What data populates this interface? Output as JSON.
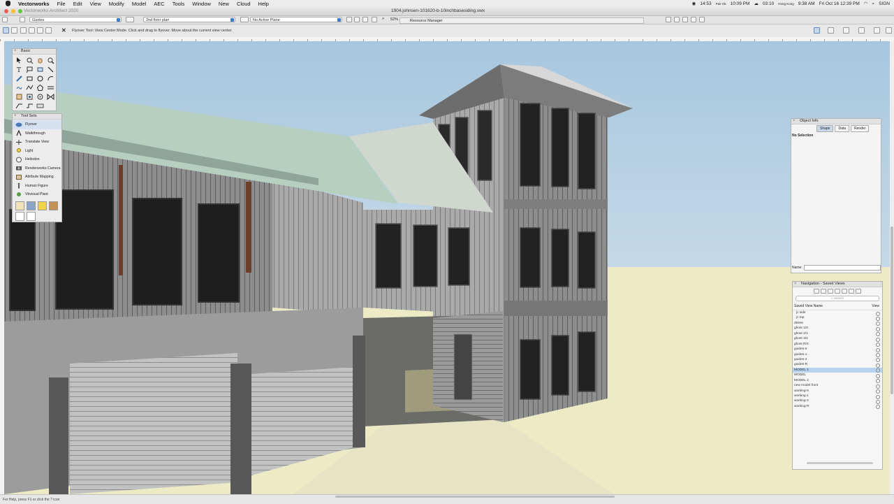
{
  "menubar": {
    "app": "Vectorworks",
    "items": [
      "File",
      "Edit",
      "View",
      "Modify",
      "Model",
      "AEC",
      "Tools",
      "Window",
      "New",
      "Cloud",
      "Help"
    ],
    "status": {
      "time_1": "14:53",
      "zone_1": "Pair Ok",
      "time_2": "10:09 PM",
      "time_3": "03:10",
      "zone_2": "Hong Kong",
      "time_4": "9:38 AM",
      "datetime": "Fri Oct 16  12:39 PM",
      "user": "SIGN"
    }
  },
  "window": {
    "app_version": "Vectorworks Architect 2020",
    "document_title": "1904.johnsen-101620-b-10inchbasesiding.vwx"
  },
  "viewbar": {
    "class_dropdown": "Guides",
    "layer_dropdown": "2nd floor plan",
    "plane_dropdown": "No Active Plane",
    "zoom": "52%",
    "resource_manager_title": "Resource Manager"
  },
  "modebar": {
    "help": "Flyover Tool: View Center Mode. Click and drag to flyover.  Move about the current view center."
  },
  "basic_palette": {
    "title": "Basic"
  },
  "tool_sets": {
    "title": "Tool Sets",
    "items": [
      "Flyover",
      "Walkthrough",
      "Translate View",
      "Light",
      "Heliodon",
      "Renderworks Camera",
      "Attribute Mapping",
      "Human Figure",
      "Vbvisual Plant"
    ]
  },
  "object_info": {
    "title": "Object Info",
    "tabs": [
      "Shape",
      "Data",
      "Render"
    ],
    "selection": "No Selection",
    "name_label": "Name:"
  },
  "navigation": {
    "title": "Navigation - Saved Views",
    "search_placeholder": "Search",
    "col_name": "Saved View Name",
    "col_view": "View",
    "views": [
      "jc side",
      "jc top",
      "delete",
      "ghost 1/0",
      "ghost 2/1",
      "ghost 3/2",
      "ghost R/2",
      "guides-0",
      "guides-1",
      "guides-2",
      "guides-R",
      "MODEL 1",
      "MODEL",
      "MODEL 2",
      "new model front",
      "working-0",
      "working-1",
      "working-2",
      "working-R"
    ],
    "selected_index": 11
  },
  "statusbar": {
    "text": "For Help, press F1 or click the ? icon"
  },
  "colors": {
    "sky_top": "#a7c6de",
    "sky_bottom": "#e2edf2",
    "ground": "#ecebc6",
    "roof": "#b7cfc0",
    "siding": "#8a8a8a",
    "selection": "#b8d3ef"
  }
}
